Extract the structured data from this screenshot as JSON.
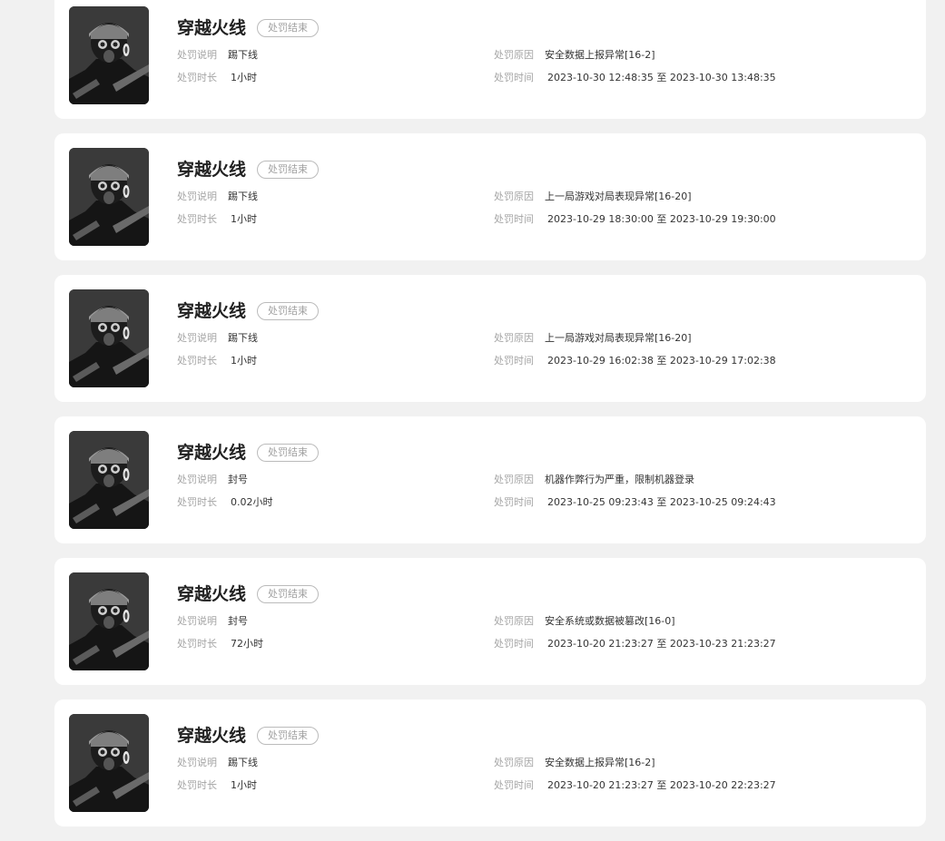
{
  "labels": {
    "desc": "处罚说明",
    "duration": "处罚时长",
    "reason": "处罚原因",
    "time": "处罚时间"
  },
  "records": [
    {
      "game": "穿越火线",
      "status": "处罚结束",
      "desc": "踢下线",
      "duration": "1小时",
      "reason": "安全数据上报异常[16-2]",
      "time": "2023-10-30 12:48:35 至 2023-10-30 13:48:35"
    },
    {
      "game": "穿越火线",
      "status": "处罚结束",
      "desc": "踢下线",
      "duration": "1小时",
      "reason": "上一局游戏对局表现异常[16-20]",
      "time": "2023-10-29 18:30:00 至 2023-10-29 19:30:00"
    },
    {
      "game": "穿越火线",
      "status": "处罚结束",
      "desc": "踢下线",
      "duration": "1小时",
      "reason": "上一局游戏对局表现异常[16-20]",
      "time": "2023-10-29 16:02:38 至 2023-10-29 17:02:38"
    },
    {
      "game": "穿越火线",
      "status": "处罚结束",
      "desc": "封号",
      "duration": "0.02小时",
      "reason": "机器作弊行为严重，限制机器登录",
      "time": "2023-10-25 09:23:43 至 2023-10-25 09:24:43"
    },
    {
      "game": "穿越火线",
      "status": "处罚结束",
      "desc": "封号",
      "duration": "72小时",
      "reason": "安全系统或数据被篡改[16-0]",
      "time": "2023-10-20 21:23:27 至 2023-10-23 21:23:27"
    },
    {
      "game": "穿越火线",
      "status": "处罚结束",
      "desc": "踢下线",
      "duration": "1小时",
      "reason": "安全数据上报异常[16-2]",
      "time": "2023-10-20 21:23:27 至 2023-10-20 22:23:27"
    }
  ]
}
